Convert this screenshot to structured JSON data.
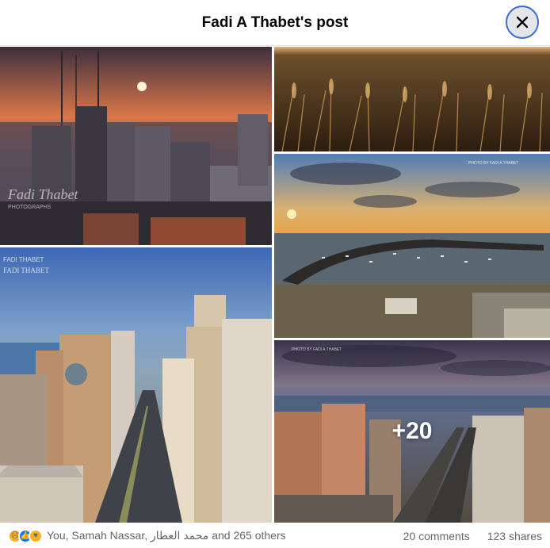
{
  "header": {
    "title": "Fadi A Thabet's post"
  },
  "photos": [
    {
      "name": "photo-sunset-city",
      "watermark": "Fadi Thabet",
      "watermark_sub": "PHOTOGRAPHS"
    },
    {
      "name": "photo-wheat-field"
    },
    {
      "name": "photo-gaza-port-sunset",
      "watermark": "PHOTO BY FADI A THABET"
    },
    {
      "name": "photo-gaza-city-skyline",
      "watermark": "FADI THABET",
      "watermark_sub": "FADI THABET"
    },
    {
      "name": "photo-gaza-street",
      "watermark": "PHOTO BY FADI A THABET"
    }
  ],
  "more_count": "+20",
  "footer": {
    "reaction_icons": [
      "sad-reaction-icon",
      "like-reaction-icon",
      "care-reaction-icon"
    ],
    "reaction_text": "You, Samah Nassar, محمد العطار and 265 others",
    "comments": "20 comments",
    "shares": "123 shares"
  }
}
